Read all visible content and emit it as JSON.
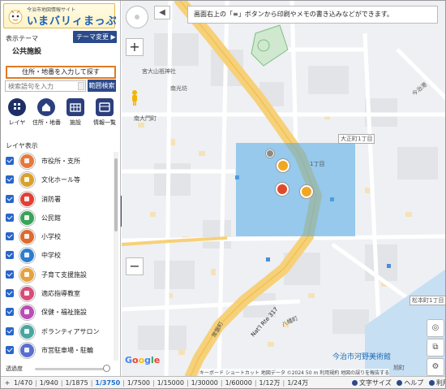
{
  "logo": {
    "subtitle": "今治市地図情報サイト",
    "title": "いまバリィまっぷ"
  },
  "theme": {
    "label": "表示テーマ",
    "name": "公共施設",
    "change_button": "テーマ変更 ▶"
  },
  "search": {
    "address_button": "住所・地番を入力して探す",
    "keyword_placeholder": "検索語句を入力",
    "range_button": "範囲検索"
  },
  "tabs": [
    {
      "label": "レイヤ",
      "icon": "layers-icon"
    },
    {
      "label": "住所・地番",
      "icon": "house-icon"
    },
    {
      "label": "施設",
      "icon": "building-icon"
    },
    {
      "label": "情報一覧",
      "icon": "list-icon"
    }
  ],
  "layers": {
    "title": "レイヤ表示",
    "items": [
      {
        "label": "市役所・支所",
        "color": "#e8783a"
      },
      {
        "label": "文化ホール等",
        "color": "#d9a12e"
      },
      {
        "label": "消防署",
        "color": "#e53f35"
      },
      {
        "label": "公民館",
        "color": "#3aa35a"
      },
      {
        "label": "小学校",
        "color": "#e06a2a"
      },
      {
        "label": "中学校",
        "color": "#2c7ed0"
      },
      {
        "label": "子育て支援施設",
        "color": "#e6a23c"
      },
      {
        "label": "適応指導教室",
        "color": "#d94d7a"
      },
      {
        "label": "保健・福祉施設",
        "color": "#b94fb5"
      },
      {
        "label": "ボランティアサロン",
        "color": "#49a6a0"
      },
      {
        "label": "市営駐車場・駐輪",
        "color": "#5a6fcf"
      }
    ]
  },
  "opacity_label": "透過度",
  "map": {
    "notice": "画面右上の「≡」ボタンから印刷やメモの書き込みなどができます。",
    "labels": {
      "shrine": "宮大山祇神社",
      "minamiko": "南光坊",
      "minamiomon": "南大門町",
      "imabari_port": "今治港",
      "daiku3": "大正町1丁目",
      "matsumoto": "松本町1丁目",
      "sambu": "今治市河野美術館",
      "yakuma": "八幡町",
      "hatchome": "1丁目",
      "asahi": "旭町",
      "route317": "Nat'l Rte 317",
      "tokiwa": "常盤町"
    },
    "attribution": "キーボード ショートカット 地図データ ©2024 50 m 利用規約 地図の誤りを報告する",
    "google": "Google"
  },
  "scales": [
    "1/470",
    "1/940",
    "1/1875",
    "1/3750",
    "1/7500",
    "1/15000",
    "1/30000",
    "1/60000",
    "1/12万",
    "1/24万"
  ],
  "active_scale": "1/3750",
  "footer_links": [
    "文字サイズ",
    "ヘルプ",
    "利用規約"
  ]
}
